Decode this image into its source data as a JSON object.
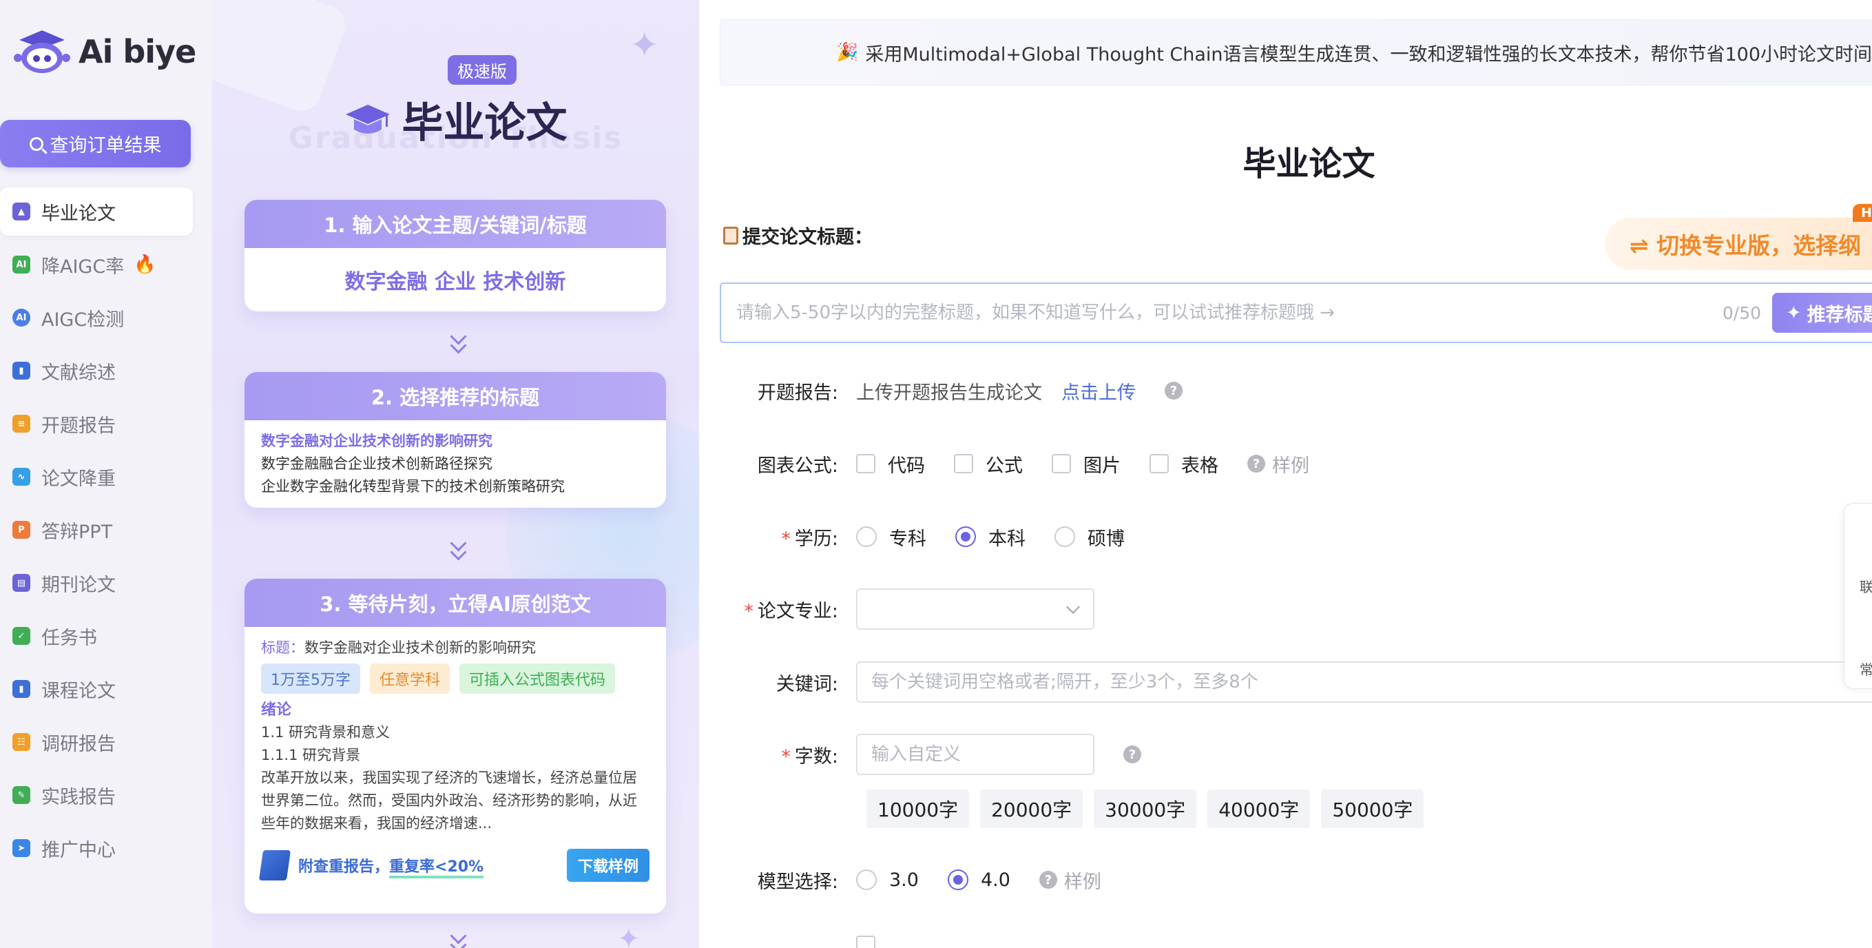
{
  "brand": {
    "logo_text": "Ai biye"
  },
  "sidebar": {
    "order_button": "查询订单结果",
    "items": [
      {
        "label": "毕业论文",
        "icon": "graduation-cap-icon",
        "color": "#6b63d6",
        "active": true
      },
      {
        "label": "降AIGC率",
        "icon": "ai-badge-icon",
        "color": "#3fae54",
        "hot": true
      },
      {
        "label": "AIGC检测",
        "icon": "ai-detect-icon",
        "color": "#4a7ee6"
      },
      {
        "label": "文献综述",
        "icon": "bookmark-icon",
        "color": "#3d6fd6"
      },
      {
        "label": "开题报告",
        "icon": "report-icon",
        "color": "#f0a02a"
      },
      {
        "label": "论文降重",
        "icon": "chart-line-icon",
        "color": "#34a0e6"
      },
      {
        "label": "答辩PPT",
        "icon": "ppt-icon",
        "color": "#ef7a3a"
      },
      {
        "label": "期刊论文",
        "icon": "journal-icon",
        "color": "#6b63d6"
      },
      {
        "label": "任务书",
        "icon": "clipboard-check-icon",
        "color": "#3fae54"
      },
      {
        "label": "课程论文",
        "icon": "book-icon",
        "color": "#3d6fd6"
      },
      {
        "label": "调研报告",
        "icon": "survey-icon",
        "color": "#f0a02a"
      },
      {
        "label": "实践报告",
        "icon": "practice-icon",
        "color": "#3fae54"
      },
      {
        "label": "推广中心",
        "icon": "paper-plane-icon",
        "color": "#3a86e6"
      }
    ]
  },
  "promo": {
    "badge": "极速版",
    "title": "毕业论文",
    "subtitle": "Graduation Thesis",
    "step1": {
      "header": "1. 输入论文主题/关键词/标题",
      "keywords": "数字金融 企业 技术创新"
    },
    "step2": {
      "header": "2. 选择推荐的标题",
      "titles": [
        "数字金融对企业技术创新的影响研究",
        "数字金融融合企业技术创新路径探究",
        "企业数字金融化转型背景下的技术创新策略研究"
      ]
    },
    "step3": {
      "header": "3. 等待片刻，立得AI原创范文",
      "title_label": "标题：",
      "title_value": "数字金融对企业技术创新的影响研究",
      "tags": [
        "1万至5万字",
        "任意学科",
        "可插入公式图表代码"
      ],
      "section": "绪论",
      "lines": [
        "1.1 研究背景和意义",
        "1.1.1 研究背景",
        "改革开放以来，我国实现了经济的飞速增长，经济总量位居世界第二位。然而，受国内外政治、经济形势的影响，从近些年的数据来看，我国的经济增速..."
      ],
      "footer_text_a": "附查重报告，",
      "footer_text_b": "重复率<20%",
      "download_button": "下载样例"
    }
  },
  "main": {
    "notice": "采用Multimodal+Global Thought Chain语言模型生成连贯、一致和逻辑性强的长文本技术，帮你节省100小时论文时间",
    "page_title": "毕业论文",
    "submit_label": "提交论文标题：",
    "pro_button": "⇌ 切换专业版，选择纲",
    "hot_badge": "HO",
    "title_input": {
      "placeholder": "请输入5-50字以内的完整标题，如果不知道写什么，可以试试推荐标题哦 →",
      "value": "",
      "counter": "0/50"
    },
    "recommend_button": "推荐标题",
    "proposal": {
      "label": "开题报告:",
      "text": "上传开题报告生成论文",
      "link": "点击上传"
    },
    "charts": {
      "label": "图表公式:",
      "options": [
        "代码",
        "公式",
        "图片",
        "表格"
      ],
      "sample": "样例"
    },
    "education": {
      "label": "学历:",
      "options": [
        "专科",
        "本科",
        "硕博"
      ],
      "selected": "本科"
    },
    "major": {
      "label": "论文专业:",
      "value": ""
    },
    "keywords": {
      "label": "关键词:",
      "placeholder": "每个关键词用空格或者;隔开，至少3个，至多8个"
    },
    "word_count": {
      "label": "字数:",
      "placeholder": "输入自定义",
      "options": [
        "10000字",
        "20000字",
        "30000字",
        "40000字",
        "50000字"
      ]
    },
    "model": {
      "label": "模型选择:",
      "options": [
        "3.0",
        "4.0"
      ],
      "selected": "4.0",
      "sample": "样例"
    },
    "side_panel": {
      "item1": "联",
      "item2": "常"
    }
  }
}
